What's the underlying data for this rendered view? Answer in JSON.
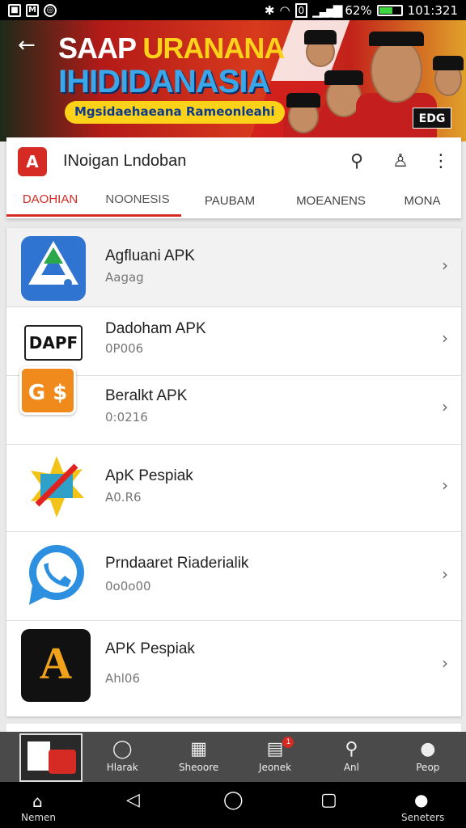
{
  "status_bar": {
    "battery_percent": "62%",
    "time": "101:321",
    "battery_level": 0.62
  },
  "banner": {
    "headline_white": "SAAP ",
    "headline_yellow": "URANANA",
    "subheadline": "IHIDIDANASIA",
    "tagline": "Mgsidaehaeana Rameonleahi",
    "badge": "EDG"
  },
  "app_bar": {
    "logo_letter": "A",
    "title": "INoigan Lndoban",
    "actions": [
      "search-icon",
      "account-icon",
      "more-icon"
    ]
  },
  "tabs": [
    {
      "label": "DAOHIAN",
      "active": true
    },
    {
      "label": "NOONESIS",
      "active": false
    },
    {
      "label": "PAUBAM",
      "active": false
    },
    {
      "label": "MOEANENS",
      "active": false
    },
    {
      "label": "MONA",
      "active": false
    }
  ],
  "apps": [
    {
      "name": "Agfluani APK",
      "sub": "Aagag",
      "icon": "drive-triangle-icon",
      "color": "#2f74d0"
    },
    {
      "name": "Dadoham APK",
      "sub": "0P006",
      "icon": "dapf-icon",
      "icon_text": "DAPF",
      "color": "#ffffff"
    },
    {
      "name": "Beralkt APK",
      "sub": "0:0216",
      "icon": "orange-box-icon",
      "icon_text": "G $",
      "color": "#f08a1c"
    },
    {
      "name": "ApK Pespiak",
      "sub": "A0.R6",
      "icon": "star-cross-icon",
      "color": "#f2c418"
    },
    {
      "name": "Prndaaret Riaderialik",
      "sub": "0o0o00",
      "icon": "chat-phone-icon",
      "color": "#2d8fe0"
    },
    {
      "name": "APK Pespiak",
      "sub": "Ahl06",
      "icon": "game-a-icon",
      "icon_text": "A",
      "color": "#111111"
    }
  ],
  "bottom_nav": [
    {
      "label": "Hlarak",
      "icon": "circle-icon"
    },
    {
      "label": "Sheoore",
      "icon": "grid-icon"
    },
    {
      "label": "Jeonek",
      "icon": "inbox-icon",
      "badge": "1"
    },
    {
      "label": "Anl",
      "icon": "search-icon"
    },
    {
      "label": "Peop",
      "icon": "person-icon"
    }
  ],
  "system_nav": {
    "left_label": "Nemen",
    "right_label": "Seneters",
    "buttons": [
      "home-icon",
      "back-icon",
      "circle-home-icon",
      "recents-icon",
      "user-circle-icon"
    ]
  }
}
